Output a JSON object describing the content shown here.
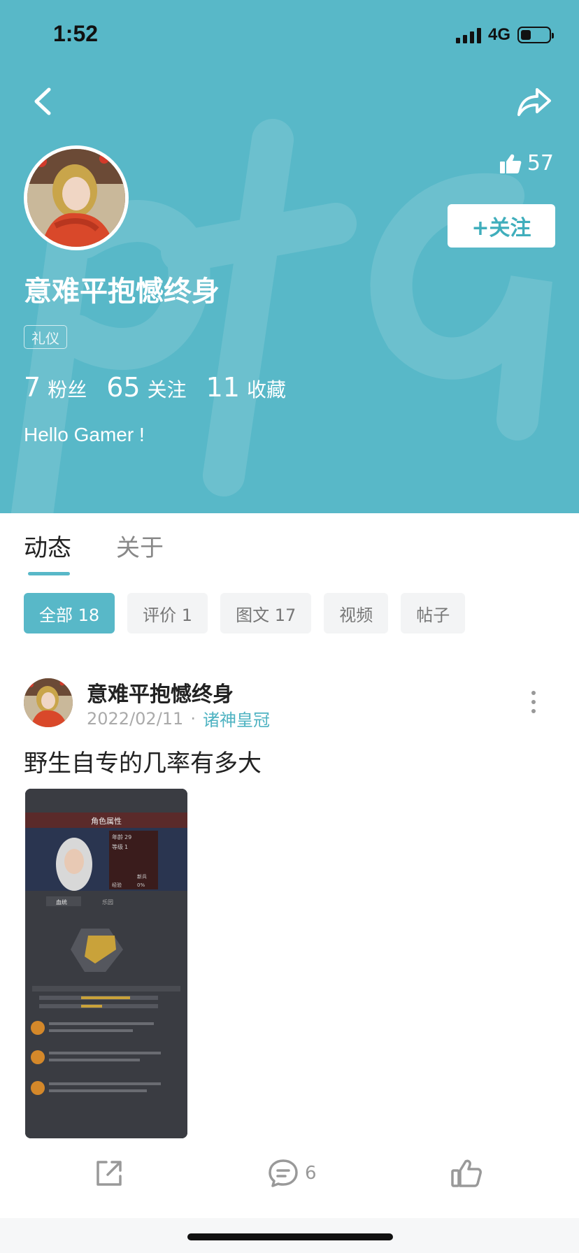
{
  "status": {
    "time": "1:52",
    "network": "4G"
  },
  "profile": {
    "likes": "57",
    "follow_label": "+关注",
    "name": "意难平抱憾终身",
    "tag": "礼仪",
    "stats": [
      {
        "num": "7",
        "label": "粉丝"
      },
      {
        "num": "65",
        "label": "关注"
      },
      {
        "num": "11",
        "label": "收藏"
      }
    ],
    "bio": "Hello Gamer !"
  },
  "tabs": [
    {
      "label": "动态",
      "active": true
    },
    {
      "label": "关于",
      "active": false
    }
  ],
  "filters": [
    {
      "label": "全部 18",
      "active": true
    },
    {
      "label": "评价 1",
      "active": false
    },
    {
      "label": "图文 17",
      "active": false
    },
    {
      "label": "视频",
      "active": false
    },
    {
      "label": "帖子",
      "active": false
    }
  ],
  "post": {
    "author": "意难平抱憾终身",
    "date": "2022/02/11",
    "separator": "·",
    "game": "诸神皇冠",
    "text": "野生自专的几率有多大",
    "comment_count": "6",
    "image_texts": {
      "title": "角色属性",
      "age_label": "年龄",
      "age": "29",
      "level_label": "等级",
      "level": "1",
      "class": "新兵",
      "exp_label": "经验",
      "exp": "0%",
      "tab1": "血统",
      "tab2": "乐园"
    }
  },
  "colors": {
    "accent": "#58b8c8",
    "follow_text": "#40aebc",
    "game_link": "#4fb3c2"
  }
}
